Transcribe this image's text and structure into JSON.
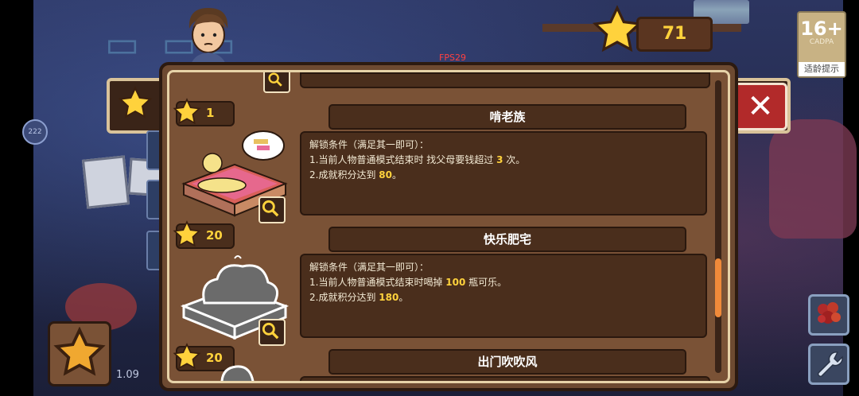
{
  "hud": {
    "score": "71",
    "fps": "FPS29",
    "age_rating": {
      "number": "16+",
      "org": "CADPA",
      "label": "适龄提示"
    },
    "version": "1.09"
  },
  "colors": {
    "accent_yellow": "#ffd23c",
    "panel_brown": "#7a5236",
    "close_red": "#b22a2a",
    "scroll_orange": "#f08a3a"
  },
  "icons": [
    "star-icon",
    "close-icon",
    "magnifier-icon",
    "avatar-icon",
    "bouquet-icon",
    "wrench-icon"
  ],
  "entries": [
    {
      "cost": "1",
      "title": "啃老族",
      "desc_title": "解锁条件（满足其一即可）：",
      "line1_pre": "1.当前人物普通模式结束时 找父母要钱超过 ",
      "line1_val": "3",
      "line1_post": " 次。",
      "line2_pre": "2.成就积分达到 ",
      "line2_val": "80",
      "line2_post": "。",
      "unlocked": true
    },
    {
      "cost": "20",
      "title": "快乐肥宅",
      "desc_title": "解锁条件（满足其一即可）：",
      "line1_pre": "1.当前人物普通模式结束时喝掉 ",
      "line1_val": "100",
      "line1_post": " 瓶可乐。",
      "line2_pre": "2.成就积分达到 ",
      "line2_val": "180",
      "line2_post": "。",
      "unlocked": false
    },
    {
      "cost": "20",
      "title": "出门吹吹风"
    }
  ]
}
